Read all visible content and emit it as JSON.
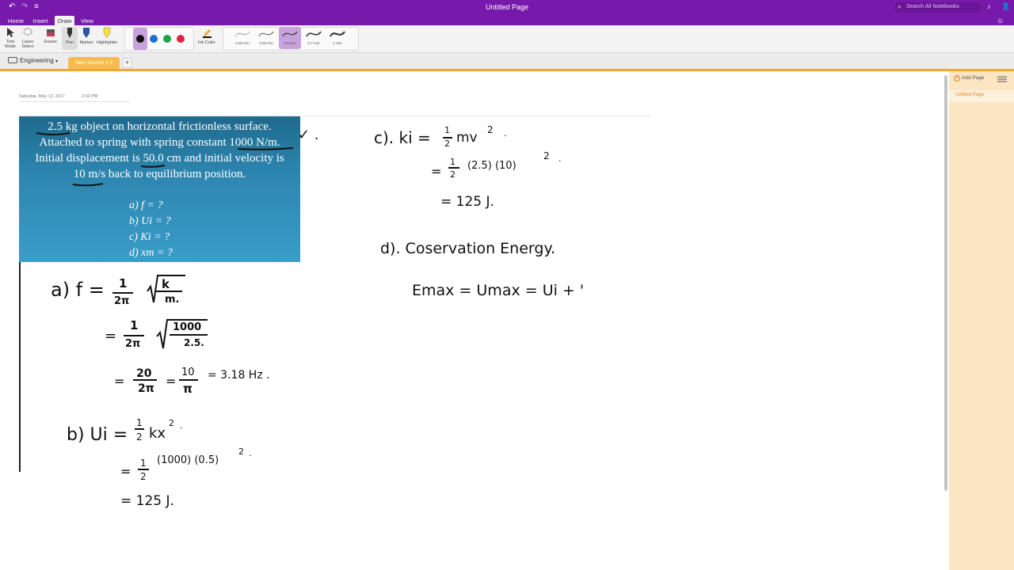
{
  "window": {
    "title": "Untitled Page",
    "search_placeholder": "Search All Notebooks"
  },
  "ribbon_tabs": [
    "Home",
    "Insert",
    "Draw",
    "View"
  ],
  "active_tab": "Draw",
  "ribbon": {
    "text_mode": "Text Mode",
    "lasso_select": "Lasso Select",
    "eraser": "Eraser",
    "pen": "Pen",
    "marker": "Marker",
    "highlighter": "Highlighter",
    "ink_color": "Ink Color",
    "colors": [
      "#111111",
      "#1f6fd6",
      "#1ca34a",
      "#e0243b"
    ],
    "thicknesses": [
      "0.25 mm",
      "0.35 mm",
      "0.5 mm",
      "0.7 mm",
      "1 mm"
    ],
    "selected_thickness": "0.5 mm"
  },
  "notebook": {
    "name": "Engineering",
    "section": "New Section 1 2"
  },
  "page": {
    "date": "Saturday, May 13, 2017",
    "time": "2:02 PM"
  },
  "problem": {
    "lines": [
      "2.5 kg object on horizontal frictionless surface.",
      "Attached to spring with spring constant 1000 N/m.",
      "Initial displacement is 50.0 cm and initial velocity is",
      "10 m/s back to equilibrium position."
    ],
    "questions": [
      "a)   f = ?",
      "b)   Ui = ?",
      "c)   Ki = ?",
      "d)   xm = ?"
    ]
  },
  "handwriting": {
    "a1_label": "a)  f =",
    "a1_frac_num": "1",
    "a1_frac_den": "2π",
    "a1_sqrt_num": "k",
    "a1_sqrt_den": "m.",
    "a2_eq": "=",
    "a2_frac_num": "1",
    "a2_frac_den": "2π",
    "a2_sqrt_num": "1000",
    "a2_sqrt_den": "2.5.",
    "a3_eq": "=",
    "a3_f1_num": "20",
    "a3_f1_den": "2π",
    "a3_mid_eq": "=",
    "a3_f2_num": "10",
    "a3_f2_den": "π",
    "a3_result": "= 3.18 Hz .",
    "b1_label": "b)  Ui =",
    "b1_frac_num": "1",
    "b1_frac_den": "2",
    "b1_rest": "kx",
    "b1_sup": "2",
    "b1_dot": ".",
    "b2_eq": "=",
    "b2_frac_num": "1",
    "b2_frac_den": "2",
    "b2_rest": "(1000) (0.5)",
    "b2_sup": "2",
    "b2_dot": ".",
    "b3": "= 125 J.",
    "c1_label": "c).  ki =",
    "c1_frac_num": "1",
    "c1_frac_den": "2",
    "c1_rest": "mv",
    "c1_sup": "2",
    "c1_dot": ".",
    "c2_eq": "=",
    "c2_frac_num": "1",
    "c2_frac_den": "2",
    "c2_rest": "(2.5) (10)",
    "c2_sup": "2",
    "c2_dot": ".",
    "c3": "= 125 J.",
    "d1": "d).   Coservation  Energy.",
    "d2": "Emax  =  Umax  =  Ui +  '",
    "check": "✓ ."
  },
  "pages_panel": {
    "add_page": "Add Page",
    "pages": [
      "Untitled Page"
    ]
  }
}
